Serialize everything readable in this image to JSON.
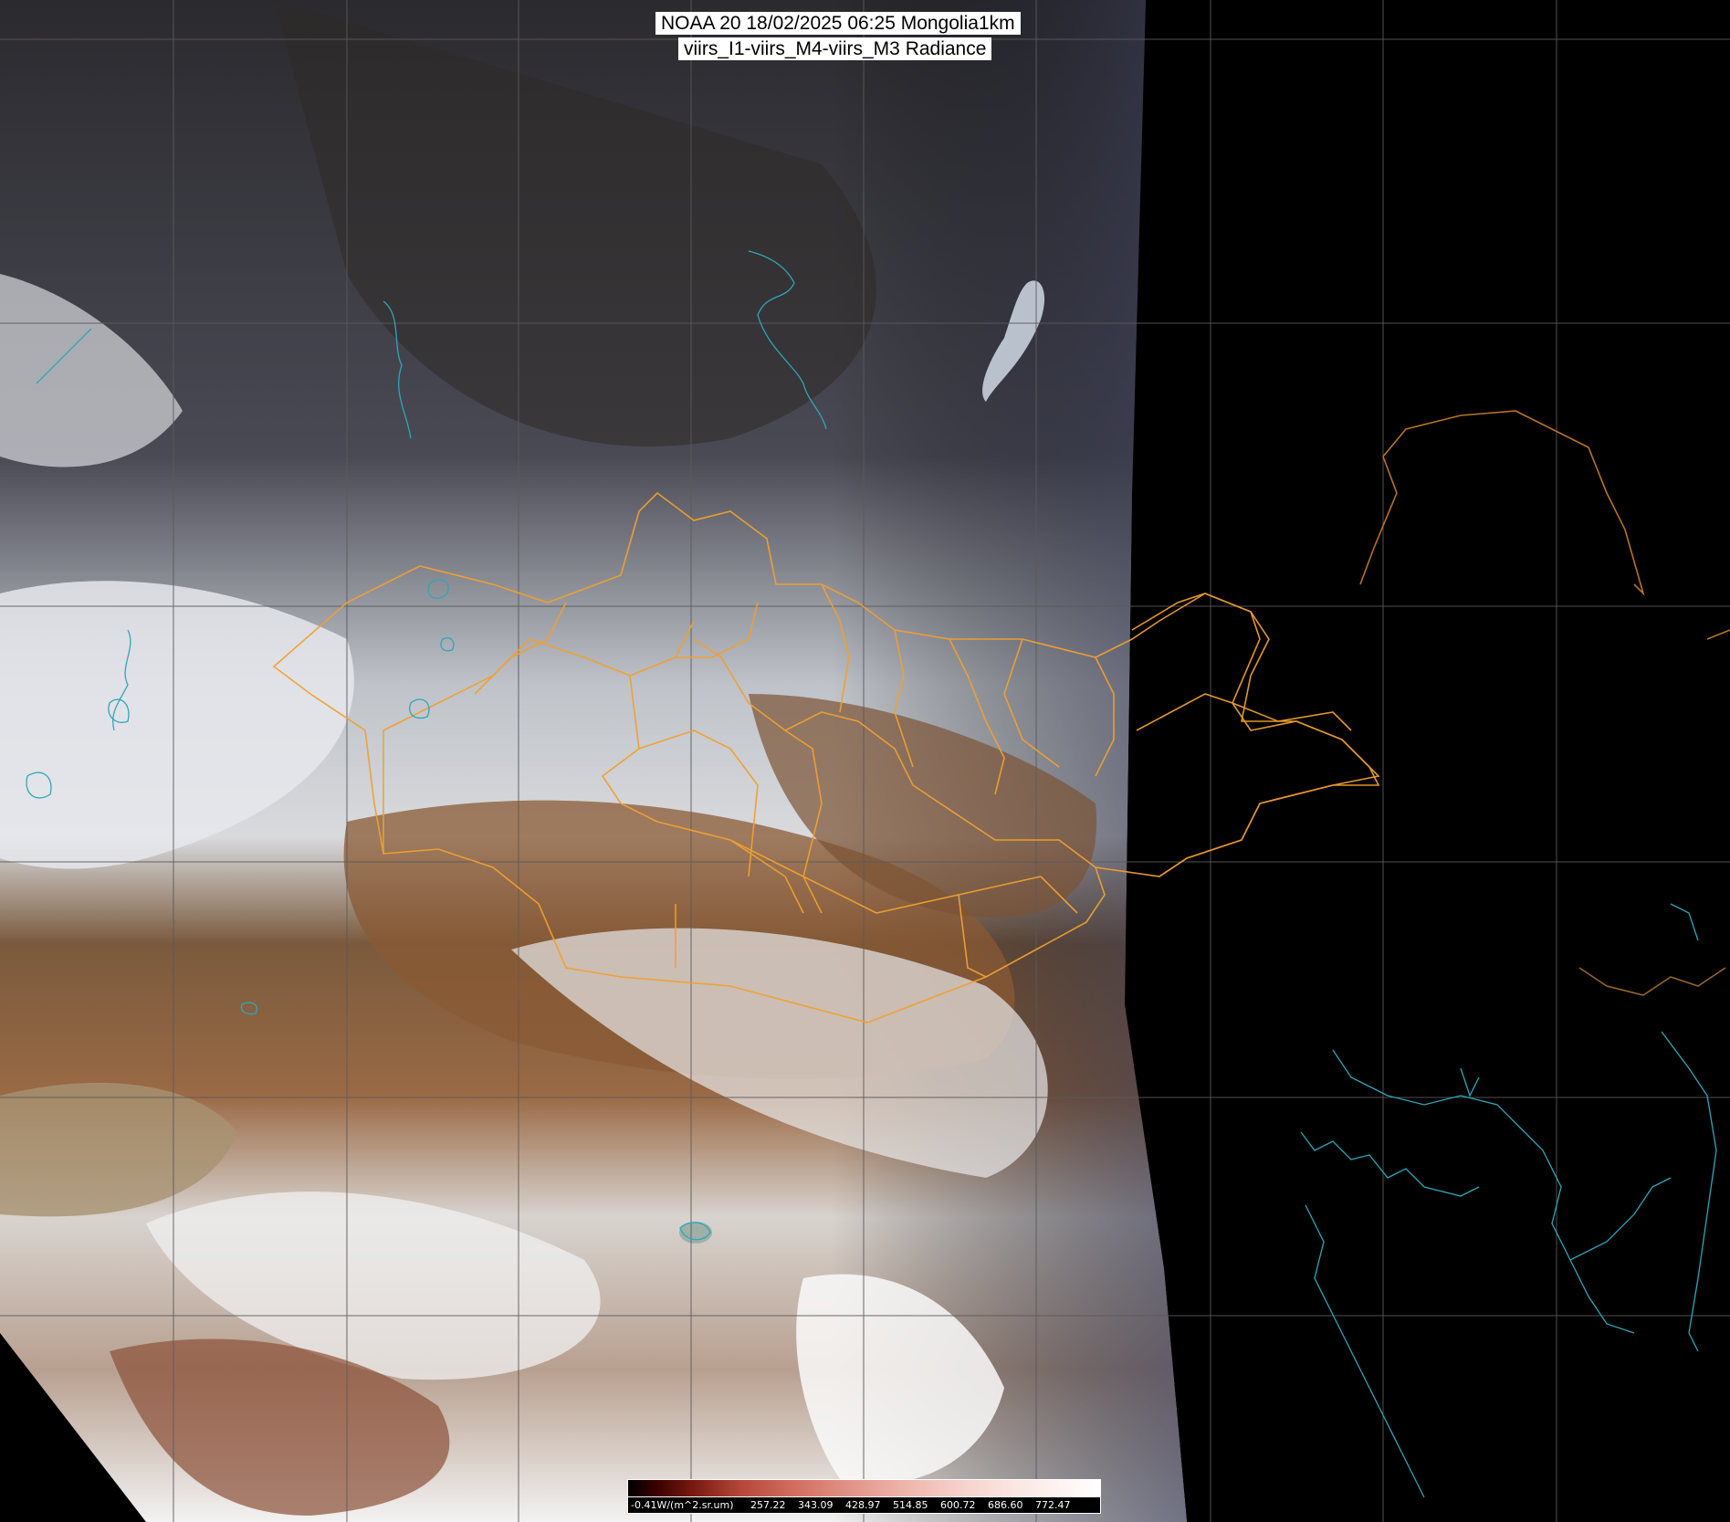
{
  "title": {
    "line1": "NOAA 20 18/02/2025 06:25 Mongolia1km",
    "line2": "viirs_I1-viirs_M4-viirs_M3 Radiance"
  },
  "colorbar": {
    "unit_label": "-0.41W/(m^2.sr.um)",
    "ticks": [
      "257.22",
      "343.09",
      "428.97",
      "514.85",
      "600.72",
      "686.60",
      "772.47"
    ]
  },
  "colors": {
    "border_lines": "#f0a030",
    "coastlines": "#2fa6b8",
    "grid": "#5a5a5a",
    "no_data": "#000000"
  }
}
